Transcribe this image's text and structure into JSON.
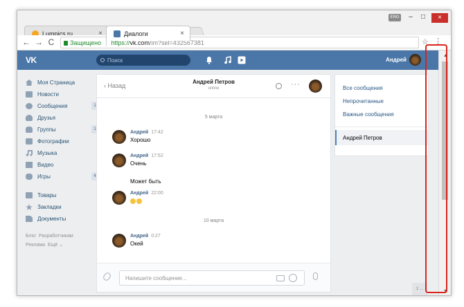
{
  "browser": {
    "tabs": [
      {
        "title": "Lumpics.ru",
        "close": "×"
      },
      {
        "title": "Диалоги",
        "close": "×"
      }
    ],
    "lang_badge": "ENG",
    "window_controls": {
      "minimize": "–",
      "maximize": "□",
      "close": "×"
    },
    "nav": {
      "back": "←",
      "forward": "→",
      "reload": "C"
    },
    "address": {
      "secure_label": "Защищено",
      "separator": "|",
      "scheme": "https://",
      "host": "vk.com",
      "path": "/im?sel=432567381"
    },
    "star": "☆",
    "menu": "⋮"
  },
  "vk_header": {
    "logo": "VK",
    "search_placeholder": "Поиск",
    "username": "Андрей",
    "icons": [
      "bell-icon",
      "music-icon",
      "play-icon"
    ]
  },
  "sidebar": {
    "items": [
      {
        "label": "Моя Страница",
        "icon": "home-icon",
        "count": null
      },
      {
        "label": "Новости",
        "icon": "news-icon",
        "count": null
      },
      {
        "label": "Сообщения",
        "icon": "messages-icon",
        "count": "1"
      },
      {
        "label": "Друзья",
        "icon": "friends-icon",
        "count": null
      },
      {
        "label": "Группы",
        "icon": "groups-icon",
        "count": "1"
      },
      {
        "label": "Фотографии",
        "icon": "photos-icon",
        "count": null
      },
      {
        "label": "Музыка",
        "icon": "music-note-icon",
        "count": null
      },
      {
        "label": "Видео",
        "icon": "video-icon",
        "count": null
      },
      {
        "label": "Игры",
        "icon": "games-icon",
        "count": "4"
      }
    ],
    "items2": [
      {
        "label": "Товары",
        "icon": "goods-icon"
      },
      {
        "label": "Закладки",
        "icon": "bookmarks-icon"
      },
      {
        "label": "Документы",
        "icon": "documents-icon"
      }
    ],
    "footer": {
      "line1": [
        "Блог",
        "Разработчикам"
      ],
      "line2": [
        "Реклама",
        "Ещё ⌄"
      ]
    }
  },
  "chat": {
    "back_label": "Назад",
    "contact_name": "Андрей Петров",
    "status": "online",
    "more": "···",
    "dates": [
      "5 марта",
      "10 марта"
    ],
    "messages": [
      {
        "author": "Андрей",
        "time": "17:42",
        "text": "Хорошо"
      },
      {
        "author": "Андрей",
        "time": "17:52",
        "text": "Очень"
      },
      {
        "author": "Андрей",
        "time": "22:00",
        "text": ""
      },
      {
        "author": "Андрей",
        "time": "0:27",
        "text": "Окей"
      }
    ],
    "continuation": "Может быть",
    "composer_placeholder": "Напишите сообщение..."
  },
  "filters": {
    "items": [
      "Все сообщения",
      "Непрочитанные",
      "Важные сообщения"
    ],
    "active": "Андрей Петров"
  },
  "page_badge": "1 ...",
  "colors": {
    "vk_blue": "#4a76a8",
    "highlight_red": "#d9241c",
    "secure_green": "#1f8b2c"
  }
}
